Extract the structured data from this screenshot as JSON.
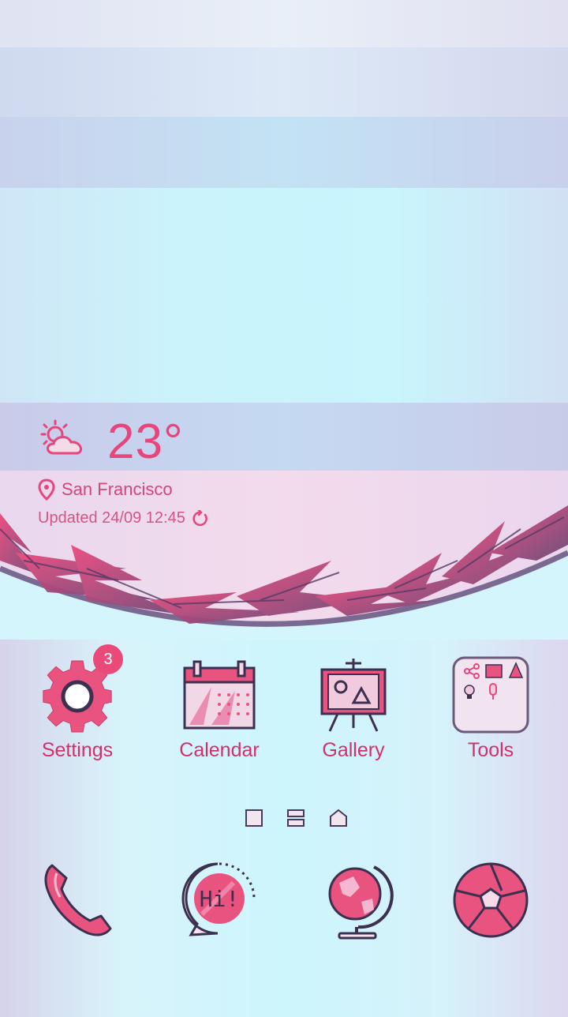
{
  "weather": {
    "icon": "partly-sunny-icon",
    "temperature": "23°",
    "location": "San Francisco",
    "updated": "Updated 24/09 12:45"
  },
  "apps": [
    {
      "label": "Settings",
      "icon": "gear-icon",
      "badge": "3"
    },
    {
      "label": "Calendar",
      "icon": "calendar-icon"
    },
    {
      "label": "Gallery",
      "icon": "easel-icon"
    },
    {
      "label": "Tools",
      "icon": "tools-folder-icon"
    }
  ],
  "pager": [
    "square-indicator",
    "menu-indicator",
    "home-indicator"
  ],
  "dock": [
    {
      "icon": "phone-icon"
    },
    {
      "icon": "messages-icon",
      "text": "Hi!"
    },
    {
      "icon": "globe-icon"
    },
    {
      "icon": "camera-shutter-icon"
    }
  ],
  "colors": {
    "accent": "#e8457c",
    "label": "#d0306c",
    "outline": "#4a3a5a",
    "fill_pink": "#ea5a8c"
  }
}
